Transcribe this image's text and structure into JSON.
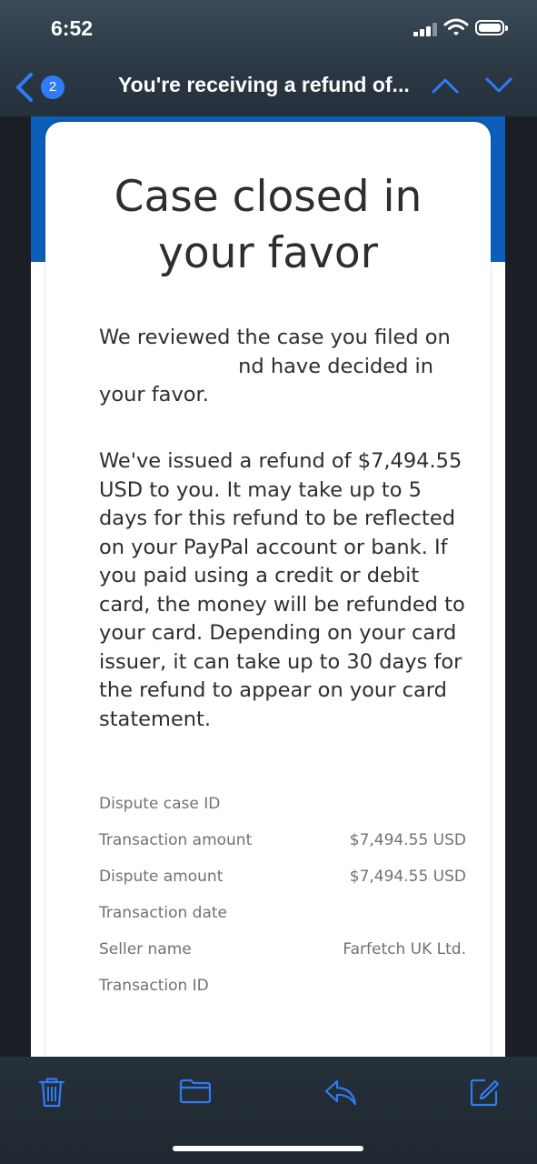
{
  "status_bar": {
    "time": "6:52"
  },
  "nav": {
    "badge_count": "2",
    "title": "You're receiving a refund of...",
    "accent_color": "#2f7cf6"
  },
  "email": {
    "brand_color": "#0b5fb8",
    "headline_line1": "Case closed in",
    "headline_line2": "your favor",
    "para1_start": "We reviewed the case you filed on",
    "para1_end": "nd have decided in your favor.",
    "para2": "We've issued a refund of $7,494.55 USD to you. It may take up to 5 days for this refund to be reflected on your PayPal account or bank. If you paid using a credit or debit card, the money will be refunded to your card. Depending on your card issuer, it can take up to 30 days for the refund to appear on your card statement.",
    "details": [
      {
        "label": "Dispute case ID",
        "value": ""
      },
      {
        "label": "Transaction amount",
        "value": "$7,494.55 USD"
      },
      {
        "label": "Dispute amount",
        "value": "$7,494.55 USD"
      },
      {
        "label": "Transaction date",
        "value": ""
      },
      {
        "label": "Seller name",
        "value": "Farfetch UK Ltd."
      },
      {
        "label": "Transaction ID",
        "value": ""
      }
    ]
  },
  "toolbar": {
    "icons": [
      "trash-icon",
      "folder-icon",
      "reply-icon",
      "compose-icon"
    ],
    "icon_color": "#2f7cf6"
  }
}
